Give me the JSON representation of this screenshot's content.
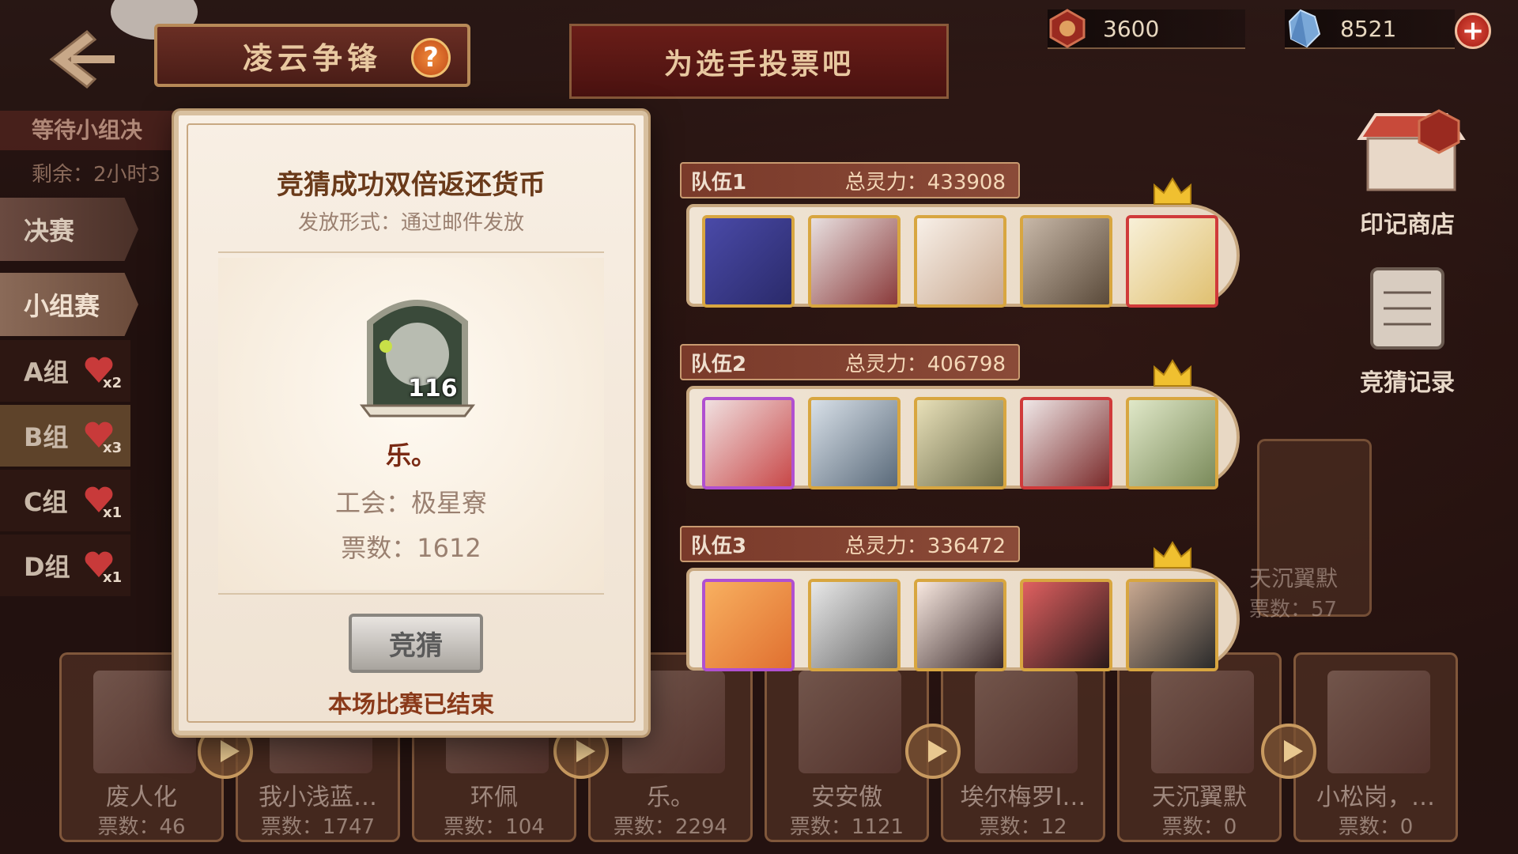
{
  "header": {
    "title": "凌云争锋",
    "help_symbol": "?",
    "banner": "为选手投票吧",
    "currency1": {
      "icon": "seal-coin-icon",
      "value": "3600"
    },
    "currency2": {
      "icon": "crystal-icon",
      "value": "8521"
    },
    "add_symbol": "+"
  },
  "sidebar": {
    "status": "等待小组决",
    "remaining": "剩余：2小时3",
    "tab_final": "决赛",
    "tab_group": "小组赛",
    "groups": [
      {
        "label": "A组",
        "mult": "x2"
      },
      {
        "label": "B组",
        "mult": "x3"
      },
      {
        "label": "C组",
        "mult": "x1"
      },
      {
        "label": "D组",
        "mult": "x1"
      }
    ]
  },
  "right_buttons": {
    "shop": "印记商店",
    "records": "竞猜记录"
  },
  "dialog": {
    "title": "竞猜成功双倍返还货币",
    "subtitle": "发放形式：通过邮件发放",
    "level": "116",
    "name": "乐。",
    "guild": "工会：极星寮",
    "votes": "票数：1612",
    "guess_button": "竞猜",
    "ended": "本场比赛已结束"
  },
  "teams": [
    {
      "label": "队伍1",
      "power": "总灵力：433908"
    },
    {
      "label": "队伍2",
      "power": "总灵力：406798"
    },
    {
      "label": "队伍3",
      "power": "总灵力：336472"
    }
  ],
  "bottom_cards": [
    {
      "name": "废人化",
      "votes": "票数：46"
    },
    {
      "name": "我小浅蓝…",
      "votes": "票数：1747"
    },
    {
      "name": "环佩",
      "votes": "票数：104"
    },
    {
      "name": "乐。",
      "votes": "票数：2294"
    },
    {
      "name": "安安傲",
      "votes": "票数：1121"
    },
    {
      "name": "埃尔梅罗I…",
      "votes": "票数：12"
    },
    {
      "name": "天沉翼默",
      "votes": "票数：0"
    },
    {
      "name": "小松岗，…",
      "votes": "票数：0"
    }
  ],
  "ghost_card": {
    "name": "天沉翼默",
    "votes": "票数：57"
  },
  "colors": {
    "accent_brown": "#7a3a2a",
    "gold_border": "#d8a640",
    "dialog_bg": "#f8efe4"
  }
}
